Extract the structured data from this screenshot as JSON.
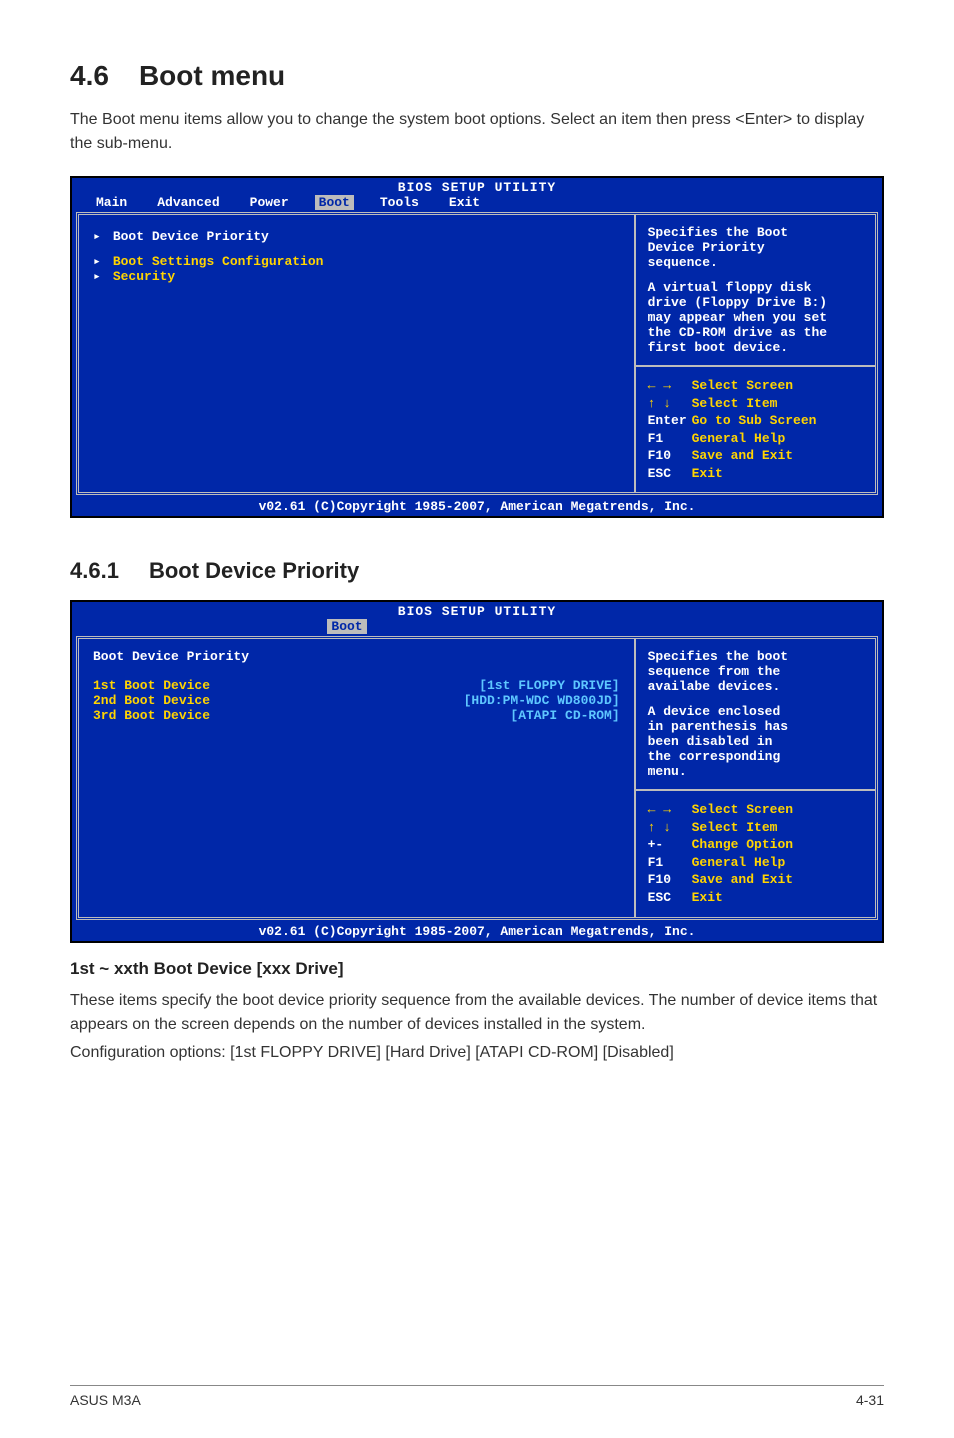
{
  "section": {
    "number": "4.6",
    "title": "Boot menu",
    "intro": "The Boot menu items allow you to change the system boot options. Select an item then press <Enter> to display the sub-menu."
  },
  "bios1": {
    "title": "BIOS SETUP UTILITY",
    "tabs": {
      "main": "Main",
      "advanced": "Advanced",
      "power": "Power",
      "boot": "Boot",
      "tools": "Tools",
      "exit": "Exit"
    },
    "items": {
      "bdp": "Boot Device Priority",
      "bsc": "Boot Settings Configuration",
      "sec": "Security"
    },
    "help": {
      "l1": "Specifies the Boot",
      "l2": "Device Priority",
      "l3": "sequence.",
      "l4": "A virtual floppy disk",
      "l5": "drive (Floppy Drive B:)",
      "l6": "may appear when you set",
      "l7": "the CD-ROM drive as the",
      "l8": "first boot device."
    },
    "keys": {
      "selScreen": "Select Screen",
      "selItem": "Select Item",
      "enter": "Enter",
      "enterDesc": "Go to Sub Screen",
      "f1": "F1",
      "f1Desc": "General Help",
      "f10": "F10",
      "f10Desc": "Save and Exit",
      "esc": "ESC",
      "escDesc": "Exit"
    },
    "footer": "v02.61 (C)Copyright 1985-2007, American Megatrends, Inc."
  },
  "subsection": {
    "number": "4.6.1",
    "title": "Boot Device Priority"
  },
  "bios2": {
    "title": "BIOS SETUP UTILITY",
    "tab": "Boot",
    "header": "Boot Device Priority",
    "rows": {
      "r1": {
        "label": "1st Boot Device",
        "val": "[1st FLOPPY DRIVE]"
      },
      "r2": {
        "label": "2nd Boot Device",
        "val": "[HDD:PM-WDC WD800JD]"
      },
      "r3": {
        "label": "3rd Boot Device",
        "val": "[ATAPI CD-ROM]"
      }
    },
    "help": {
      "l1": "Specifies the boot",
      "l2": "sequence from the",
      "l3": "availabe devices.",
      "l4": "A device enclosed",
      "l5": "in parenthesis has",
      "l6": "been disabled in",
      "l7": "the corresponding",
      "l8": "menu."
    },
    "keys": {
      "selScreen": "Select Screen",
      "selItem": "Select Item",
      "pm": "+-",
      "pmDesc": "Change Option",
      "f1": "F1",
      "f1Desc": "General Help",
      "f10": "F10",
      "f10Desc": "Save and Exit",
      "esc": "ESC",
      "escDesc": "Exit"
    },
    "footer": "v02.61 (C)Copyright 1985-2007, American Megatrends, Inc."
  },
  "field": {
    "title": "1st ~ xxth Boot Device [xxx Drive]",
    "p1": "These items specify the boot device priority sequence from the available devices. The number of device items that appears on the screen depends on the number of devices installed in the system.",
    "p2": "Configuration options: [1st FLOPPY DRIVE] [Hard Drive] [ATAPI CD-ROM] [Disabled]"
  },
  "footer": {
    "left": "ASUS M3A",
    "right": "4-31"
  }
}
